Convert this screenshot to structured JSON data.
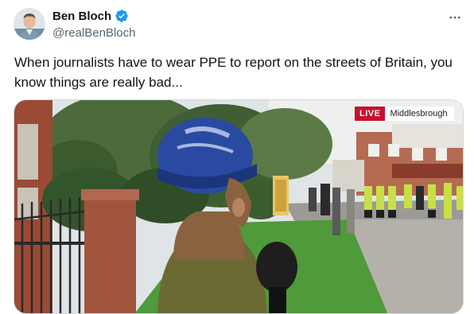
{
  "author": {
    "display_name": "Ben Bloch",
    "handle": "@realBenBloch",
    "verified": true,
    "avatar_icon": "profile-photo"
  },
  "tweet": {
    "text": "When journalists have to wear PPE to report on the streets of Britain, you know things are really bad..."
  },
  "media": {
    "live_label": "LIVE",
    "location": "Middlesbrough"
  },
  "icons": {
    "more": "more-options-icon",
    "verified": "verified-badge-icon"
  },
  "colors": {
    "verified_blue": "#1d9bf0",
    "live_red": "#c8102e",
    "text": "#0f1419",
    "secondary_text": "#536471"
  }
}
